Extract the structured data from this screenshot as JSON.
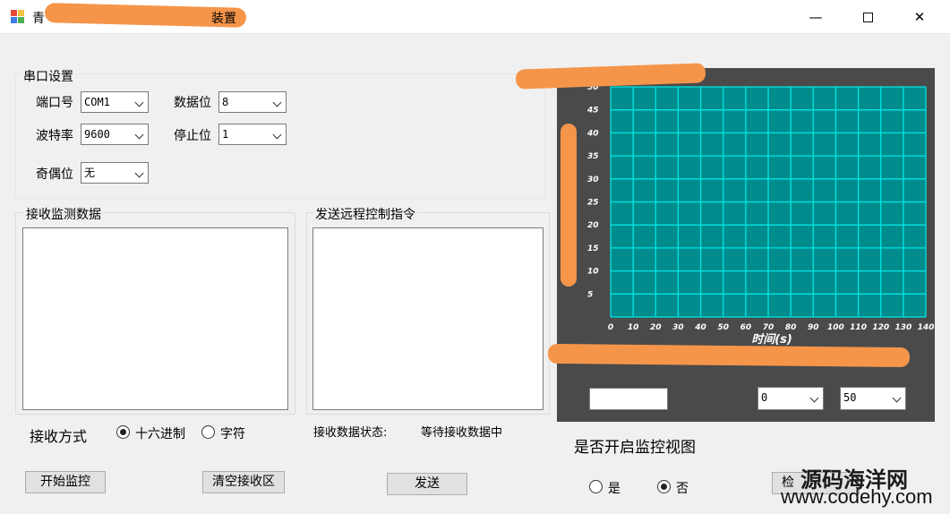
{
  "window": {
    "title": "青",
    "title_suffix": "装置",
    "controls": {
      "minimize": "—",
      "close": "✕"
    }
  },
  "serial": {
    "group_title": "串口设置",
    "port_label": "端口号",
    "port_value": "COM1",
    "baud_label": "波特率",
    "baud_value": "9600",
    "parity_label": "奇偶位",
    "parity_value": "无",
    "databits_label": "数据位",
    "databits_value": "8",
    "stopbits_label": "停止位",
    "stopbits_value": "1"
  },
  "receive": {
    "group_title": "接收监测数据",
    "mode_label": "接收方式",
    "mode_hex": "十六进制",
    "mode_char": "字符",
    "mode_selected": "hex"
  },
  "send": {
    "group_title": "发送远程控制指令",
    "status_label": "接收数据状态:",
    "status_value": "等待接收数据中"
  },
  "buttons": {
    "start": "开始监控",
    "clear": "清空接收区",
    "send": "发送",
    "check": "检"
  },
  "chart_panel": {
    "range_min_value": "0",
    "range_max_value": "50",
    "threshold_value": ""
  },
  "monitor": {
    "question": "是否开启监控视图",
    "yes": "是",
    "no": "否",
    "selected": "no"
  },
  "watermark": {
    "cn": "源码海洋网",
    "url": "www.codehy.com"
  },
  "colors": {
    "window_bg": "#f0f0f0",
    "chart_bg": "#4a4a4a",
    "plot_bg": "#008c8c",
    "grid": "#00e5e5",
    "redaction": "#f5954a"
  },
  "chart_data": {
    "type": "line",
    "xlabel": "时间(s)",
    "ylabel": "",
    "xlim": [
      0,
      140
    ],
    "ylim": [
      0,
      50
    ],
    "x_ticks": [
      0,
      10,
      20,
      30,
      40,
      50,
      60,
      70,
      80,
      90,
      100,
      110,
      120,
      130,
      140
    ],
    "y_ticks": [
      5,
      10,
      15,
      20,
      25,
      30,
      35,
      40,
      45,
      50
    ],
    "grid": true,
    "series": []
  }
}
